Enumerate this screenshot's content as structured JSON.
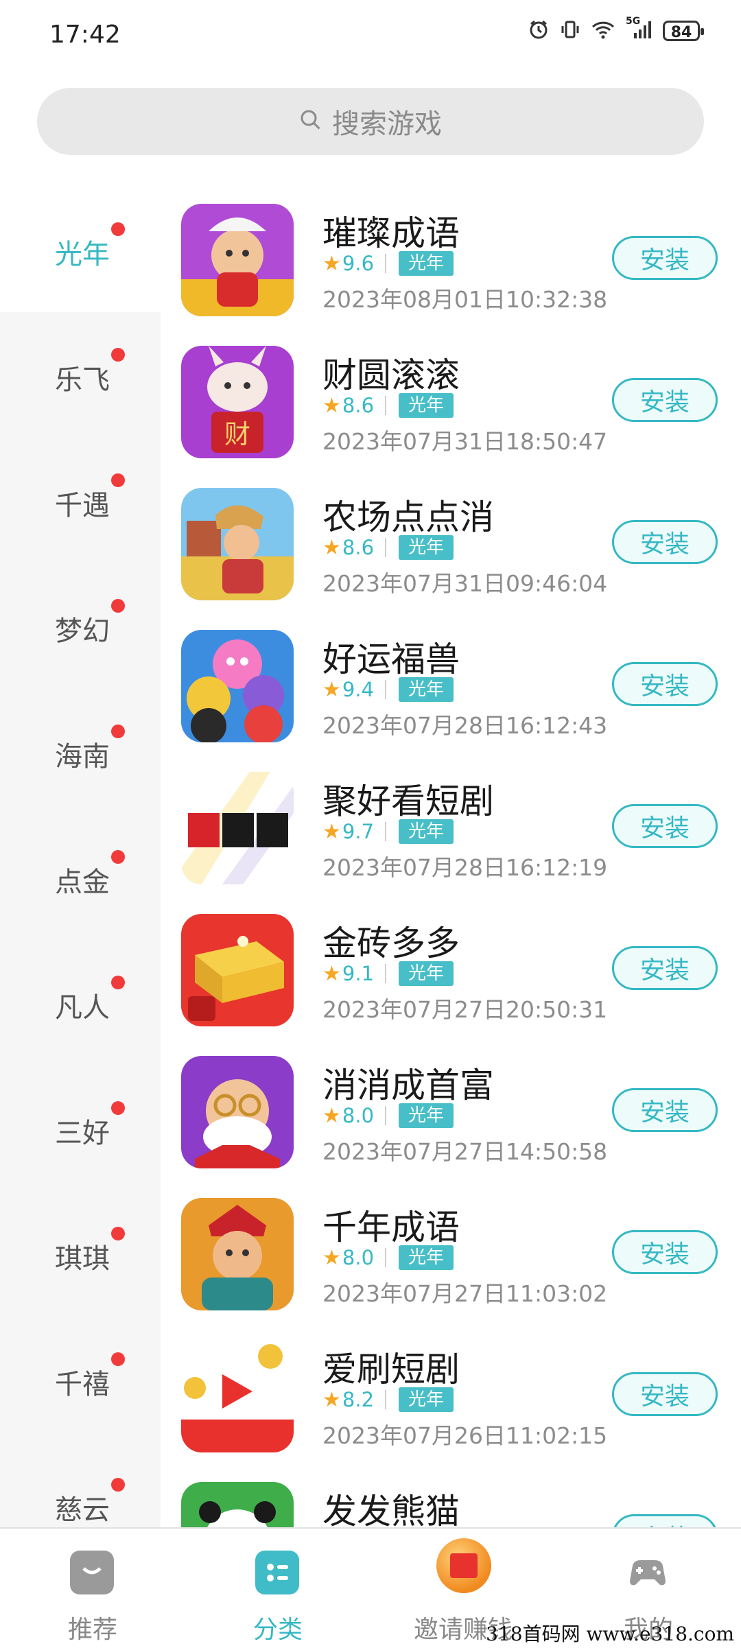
{
  "status_bar": {
    "time": "17:42",
    "network": "5G",
    "battery": "84"
  },
  "search": {
    "placeholder": "搜索游戏"
  },
  "categories": [
    {
      "label": "光年"
    },
    {
      "label": "乐飞"
    },
    {
      "label": "千遇"
    },
    {
      "label": "梦幻"
    },
    {
      "label": "海南"
    },
    {
      "label": "点金"
    },
    {
      "label": "凡人"
    },
    {
      "label": "三好"
    },
    {
      "label": "琪琪"
    },
    {
      "label": "千禧"
    },
    {
      "label": "慈云"
    }
  ],
  "active_category": "光年",
  "install_label": "安装",
  "games": [
    {
      "name": "璀璨成语",
      "rating": "9.6",
      "tag": "光年",
      "date": "2023年08月01日10:32:38"
    },
    {
      "name": "财圆滚滚",
      "rating": "8.6",
      "tag": "光年",
      "date": "2023年07月31日18:50:47"
    },
    {
      "name": "农场点点消",
      "rating": "8.6",
      "tag": "光年",
      "date": "2023年07月31日09:46:04"
    },
    {
      "name": "好运福兽",
      "rating": "9.4",
      "tag": "光年",
      "date": "2023年07月28日16:12:43"
    },
    {
      "name": "聚好看短剧",
      "rating": "9.7",
      "tag": "光年",
      "date": "2023年07月28日16:12:19"
    },
    {
      "name": "金砖多多",
      "rating": "9.1",
      "tag": "光年",
      "date": "2023年07月27日20:50:31"
    },
    {
      "name": "消消成首富",
      "rating": "8.0",
      "tag": "光年",
      "date": "2023年07月27日14:50:58"
    },
    {
      "name": "千年成语",
      "rating": "8.0",
      "tag": "光年",
      "date": "2023年07月27日11:03:02"
    },
    {
      "name": "爱刷短剧",
      "rating": "8.2",
      "tag": "光年",
      "date": "2023年07月26日11:02:15"
    },
    {
      "name": "发发熊猫",
      "rating": "",
      "tag": "",
      "date": ""
    }
  ],
  "bottom_nav": [
    {
      "label": "推荐",
      "icon": "recommend-icon"
    },
    {
      "label": "分类",
      "icon": "category-icon"
    },
    {
      "label": "邀请赚钱",
      "icon": "invite-icon"
    },
    {
      "label": "我的",
      "icon": "gamepad-icon"
    }
  ],
  "watermark": "318首码网 www.e318.com",
  "colors": {
    "accent": "#35b8c4",
    "tag_bg": "#48bfc8",
    "dot": "#f13b3b",
    "star": "#f5a623"
  }
}
